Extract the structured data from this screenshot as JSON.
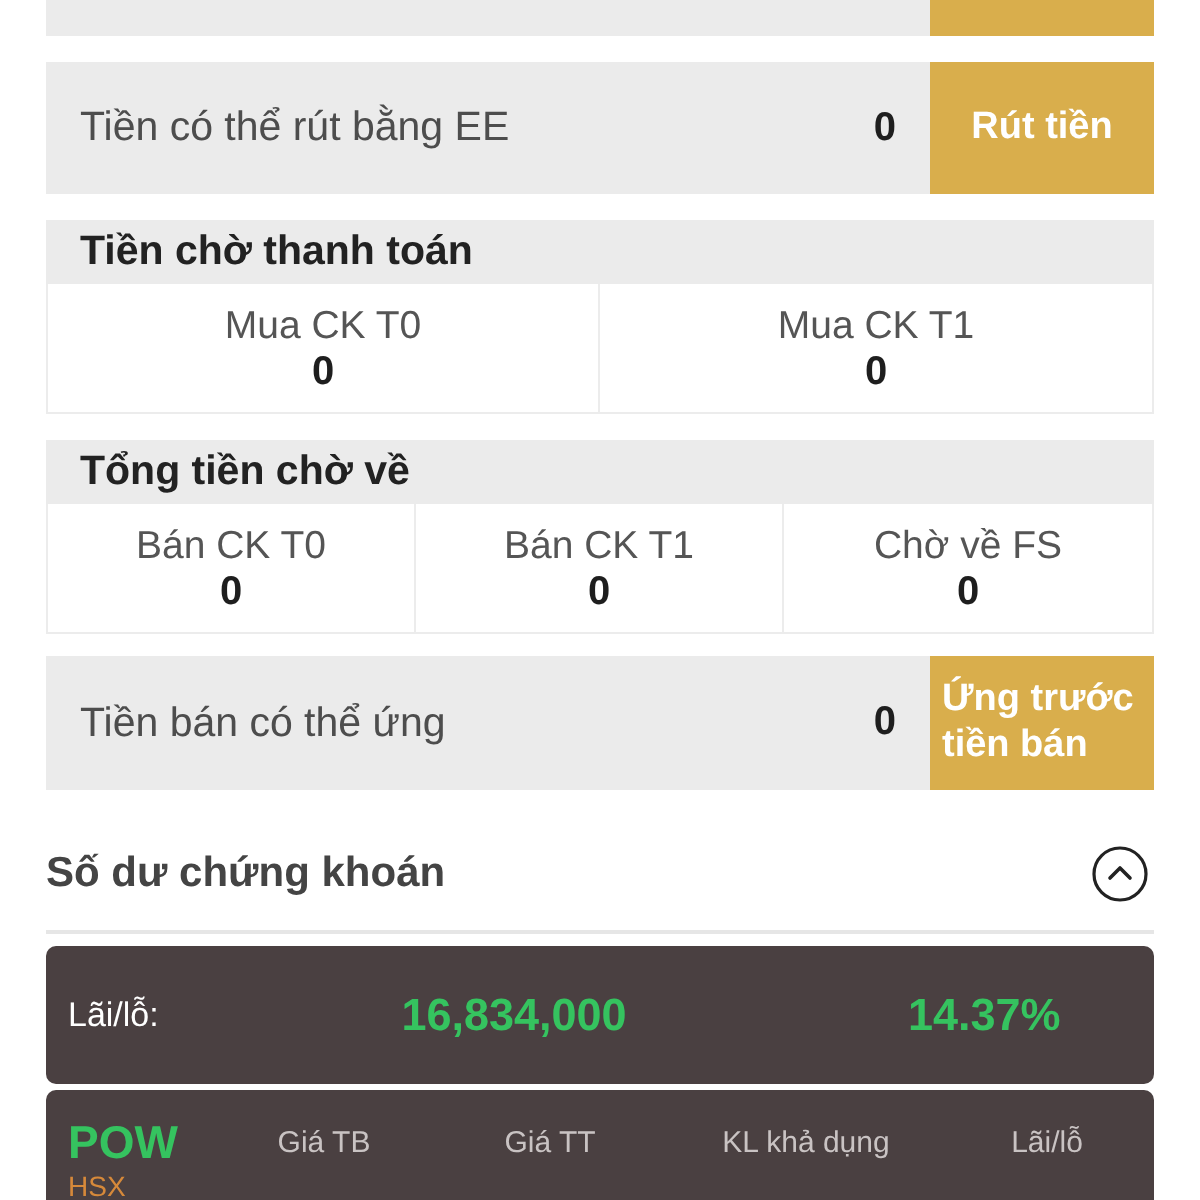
{
  "blocks": [
    {
      "kind": "cut_action"
    },
    {
      "kind": "action",
      "label": "Tiền có thể rút bằng EE",
      "value": "0",
      "button": "Rút tiền"
    },
    {
      "kind": "group",
      "title": "Tiền chờ thanh toán",
      "items": [
        {
          "label": "Mua CK T0",
          "value": "0"
        },
        {
          "label": "Mua CK T1",
          "value": "0"
        }
      ]
    },
    {
      "kind": "group",
      "title": "Tổng tiền chờ về",
      "items": [
        {
          "label": "Bán CK T0",
          "value": "0"
        },
        {
          "label": "Bán CK T1",
          "value": "0"
        },
        {
          "label": "Chờ về FS",
          "value": "0"
        }
      ]
    },
    {
      "kind": "action",
      "label": "Tiền bán có thể ứng",
      "value": "0",
      "button": "Ứng trước tiền bán"
    }
  ],
  "portfolio": {
    "title": "Số dư chứng khoán",
    "expanded": true,
    "summary": {
      "label": "Lãi/lỗ:",
      "amount": "16,834,000",
      "percent": "14.37%"
    },
    "holdings": [
      {
        "symbol": "POW",
        "exchange": "HSX",
        "columns": [
          {
            "header": "Giá TB"
          },
          {
            "header": "Giá TT"
          },
          {
            "header": "KL khả dụng"
          },
          {
            "header": "Lãi/lỗ"
          }
        ]
      }
    ]
  }
}
